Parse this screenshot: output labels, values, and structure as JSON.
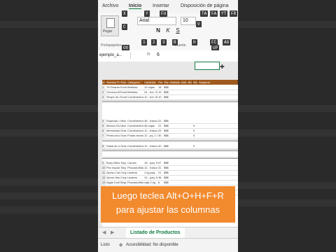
{
  "ribbon": {
    "tabs": [
      "Archivo",
      "Inicio",
      "Insertar",
      "Disposición de página"
    ],
    "active_tab": "Inicio",
    "font_name": "Arial",
    "font_size": "10",
    "paste_label": "Pegar",
    "format_buttons": [
      "N",
      "K",
      "S"
    ],
    "group_labels": [
      "Portapapeles",
      "Fuente"
    ],
    "keytips_row1": [
      "X",
      "Y",
      "FU",
      "TA",
      "FA",
      "YT",
      "FR",
      "L"
    ],
    "keytips_row2": [
      "V",
      "1",
      "2",
      "3",
      "B",
      "H",
      "FC",
      "AG"
    ],
    "keytips_row3": [
      "FF",
      "FS",
      "AL",
      "AM",
      "JU",
      "E",
      "DC"
    ],
    "keytips_row4": [
      "1",
      "2",
      "3",
      "FO",
      "AA",
      "AB",
      "FT",
      "WO",
      "DO",
      "FJ",
      "FN",
      "AR"
    ],
    "keytips_row5": [
      "FG",
      "OO",
      "FK",
      "UP"
    ],
    "c_tip": "C"
  },
  "formula_bar": {
    "name_box": "ejemplo_a...",
    "fx_label": "fx",
    "value": "6"
  },
  "sheet": {
    "columns": [
      "Id",
      "Nombre Pro",
      "Prov",
      "Categoría",
      "Cantidad",
      "Pre",
      "Pac",
      "Unidades",
      "Unid",
      "Niv",
      "Niv",
      "Suspend"
    ],
    "rows": [
      [
        "1",
        "Té Dharamsala",
        "Exoti",
        "Bebidas",
        "10 cajas",
        "18",
        "$$$",
        "",
        "",
        "",
        "",
        ""
      ],
      [
        "2",
        "Cerveza tibetana",
        "Exoti",
        "Bebidas",
        "24 - bot. 320 ml",
        "19",
        "$$$",
        "",
        "",
        "",
        "",
        ""
      ],
      [
        "3",
        "Sirope de regaliz",
        "Exoti",
        "Condimentos",
        "12 - bot. 550 ml",
        "10",
        "$$$",
        "",
        "",
        "",
        "",
        ""
      ],
      [
        "4",
        "Especias Cajun",
        "New",
        "Condimentos",
        "48 - frascos 6 oz",
        "22",
        "$$$",
        "",
        "",
        "",
        "",
        ""
      ],
      [
        "5",
        "Mezcla Gumbo",
        "New",
        "Condimentos",
        "36 cajas",
        "21",
        "$$$",
        "",
        "",
        "",
        "0",
        ""
      ],
      [
        "6",
        "Mermelada de la",
        "Graz",
        "Condimentos",
        "12 - frascos 8 oz",
        "25",
        "$$$",
        "",
        "",
        "",
        "0",
        ""
      ],
      [
        "7",
        "Peras secas org",
        "Graz",
        "Frutas secas",
        "12 - pq. 1 lb",
        "30",
        "$$$",
        "",
        "",
        "",
        "0",
        ""
      ],
      [
        "8",
        "Salsa de arándano",
        "Graz",
        "Condimentos",
        "12 - frascos 12 oz",
        "40",
        "$$$",
        "",
        "",
        "",
        "0",
        ""
      ],
      [
        "9",
        "Buey Mishi Kobe",
        "Toky",
        "Carnes",
        "18 - paq. 500 g",
        "97",
        "$$$",
        "",
        "",
        "",
        "",
        ""
      ],
      [
        "10",
        "Pez espada",
        "Toky",
        "Pescado/Marisco",
        "12 - frascos 200 ml",
        "31",
        "$$$",
        "",
        "",
        "",
        "",
        ""
      ],
      [
        "11",
        "Queso Cabrales",
        "Coop",
        "Lácteos",
        "1 kg paq.",
        "21",
        "$$$",
        "",
        "",
        "",
        "",
        ""
      ],
      [
        "12",
        "Queso Manchego",
        "Coop",
        "Lácteos",
        "10 - paq. 500 g",
        "38",
        "$$$",
        "",
        "",
        "",
        "",
        ""
      ],
      [
        "13",
        "Algas Konbu",
        "Mayu",
        "Pescado/Marisco",
        "caja 2 kg",
        "6",
        "$$$",
        "",
        "",
        "",
        "",
        ""
      ],
      [
        "14",
        "Cuajada de judías",
        "Mayu",
        "Frutas/Verduras",
        "40 - paq. 100 g",
        "23",
        "$$$",
        "",
        "",
        "",
        "",
        ""
      ],
      [
        "15",
        "Salsa de soja baja",
        "Mayu",
        "Condimentos",
        "24 - bot. 250 ml",
        "15",
        "$$$",
        "",
        "",
        "",
        "",
        ""
      ]
    ]
  },
  "caption": {
    "line1": "Luego teclea Alt+O+H+F+R",
    "line2": "para ajustar las columnas"
  },
  "sheet_tabs": {
    "active": "Listado de Productos"
  },
  "status": {
    "ready": "Listo",
    "accessibility": "Accesibilidad: No disponible"
  },
  "colors": {
    "header_brown": "#a05a1e",
    "excel_green": "#107c41",
    "caption_orange": "#f28a2e"
  }
}
